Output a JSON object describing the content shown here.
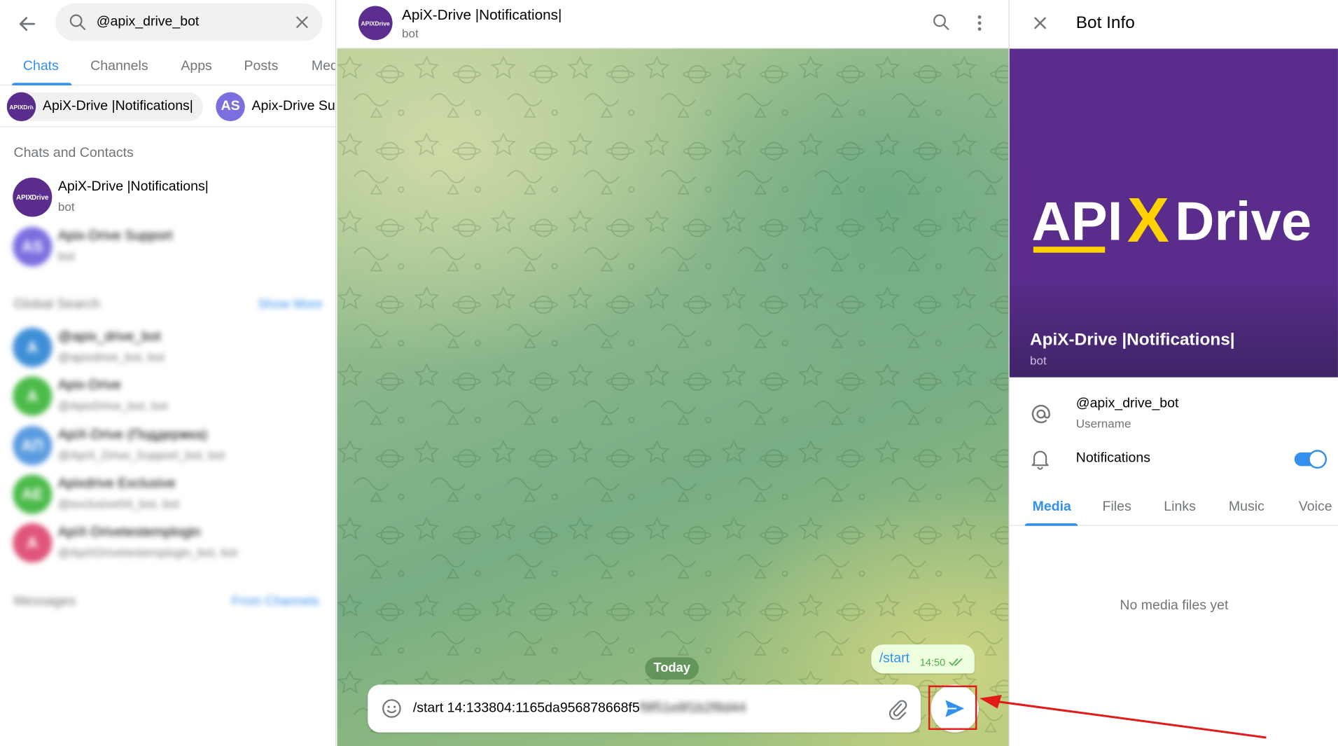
{
  "search": {
    "query": "@apix_drive_bot"
  },
  "tabs": [
    {
      "label": "Chats"
    },
    {
      "label": "Channels"
    },
    {
      "label": "Apps"
    },
    {
      "label": "Posts"
    },
    {
      "label": "Med"
    }
  ],
  "recent_chips": [
    {
      "label": "ApiX-Drive |Notifications|"
    },
    {
      "label": "Apix-Drive Su",
      "initials": "AS"
    }
  ],
  "chats_and_contacts": {
    "title": "Chats and Contacts",
    "items": [
      {
        "name": "ApiX-Drive |Notifications|",
        "sub": "bot"
      },
      {
        "name": "Apix-Drive Support",
        "sub": "bot",
        "initials": "AS"
      }
    ]
  },
  "global_search": {
    "title": "Global Search",
    "action": "Show More",
    "items": [
      {
        "name": "@apix_drive_bot",
        "sub": "@apixdrive_bot, bot",
        "initials": "A",
        "color": "#3f8fd8"
      },
      {
        "name": "Apix-Drive",
        "sub": "@ApixDrive_bot, bot",
        "initials": "A",
        "color": "#4cbb4a"
      },
      {
        "name": "ApiX-Drive (Поддержка)",
        "sub": "@ApiX_Drive_Support_bot, bot",
        "initials": "AП",
        "color": "#5a9be0"
      },
      {
        "name": "Apixdrive Exclusive",
        "sub": "@exclusive04_bot, bot",
        "initials": "AE",
        "color": "#4cbb4a"
      },
      {
        "name": "ApiX-Drivetestemplogin",
        "sub": "@ApiXDrivetestemplogin_bot, bot",
        "initials": "A",
        "color": "#e0567a"
      }
    ]
  },
  "messages_section": {
    "title": "Messages",
    "action": "From Channels"
  },
  "chat": {
    "title": "ApiX-Drive |Notifications|",
    "subtitle": "bot",
    "day": "Today",
    "message": {
      "text": "/start",
      "time": "14:50"
    },
    "composer": {
      "visible_text": "/start 14:133804:1165da956878668f5",
      "hidden_text": "f9f51e8f1b2f8d44"
    }
  },
  "bot_info": {
    "title": "Bot Info",
    "logo_text": {
      "left": "API",
      "x": "X",
      "right": "Drive"
    },
    "name": "ApiX-Drive |Notifications|",
    "sub": "bot",
    "username": "@apix_drive_bot",
    "username_label": "Username",
    "notifications_label": "Notifications",
    "notifications_on": true,
    "tabs": [
      {
        "label": "Media"
      },
      {
        "label": "Files"
      },
      {
        "label": "Links"
      },
      {
        "label": "Music"
      },
      {
        "label": "Voice"
      }
    ],
    "empty_text": "No media files yet"
  },
  "colors": {
    "accent": "#3390ec",
    "brand_purple": "#5a2d8c",
    "brand_yellow": "#ffd200",
    "annotation_red": "#e11a1a"
  }
}
